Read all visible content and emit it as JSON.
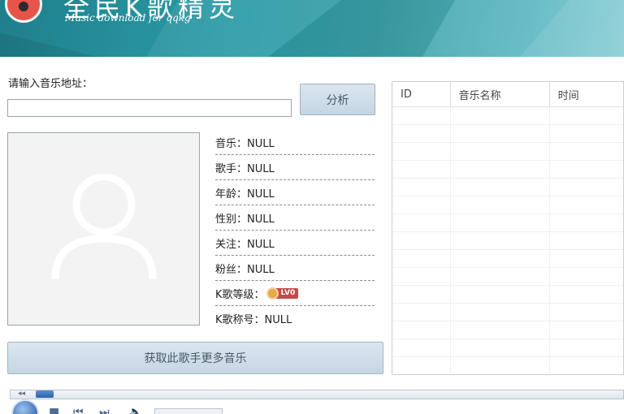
{
  "header": {
    "app_title": "全民K歌精灵",
    "subtitle": "Music download for qqkg"
  },
  "form": {
    "url_label": "请输入音乐地址：",
    "url_value": "",
    "analyze_label": "分析"
  },
  "info": {
    "rows": [
      {
        "label": "音乐：NULL"
      },
      {
        "label": "歌手：NULL"
      },
      {
        "label": "年龄：NULL"
      },
      {
        "label": "性别：NULL"
      },
      {
        "label": "关注：NULL"
      },
      {
        "label": "粉丝：NULL"
      }
    ],
    "level_label": "K歌等级：",
    "level_badge": "LV0",
    "title_label": "K歌称号：NULL"
  },
  "more_button_label": "获取此歌手更多音乐",
  "table": {
    "columns": [
      "ID",
      "音乐名称",
      "时间"
    ],
    "rows": []
  },
  "colors": {
    "header_accent": "#2a9aa5",
    "button_bg": "#c9d9e6",
    "level_badge": "#c9484a"
  },
  "icons": [
    "logo-icon",
    "avatar-placeholder-icon",
    "rewind-icon",
    "play-icon",
    "stop-icon",
    "prev-icon",
    "next-icon",
    "volume-icon"
  ]
}
